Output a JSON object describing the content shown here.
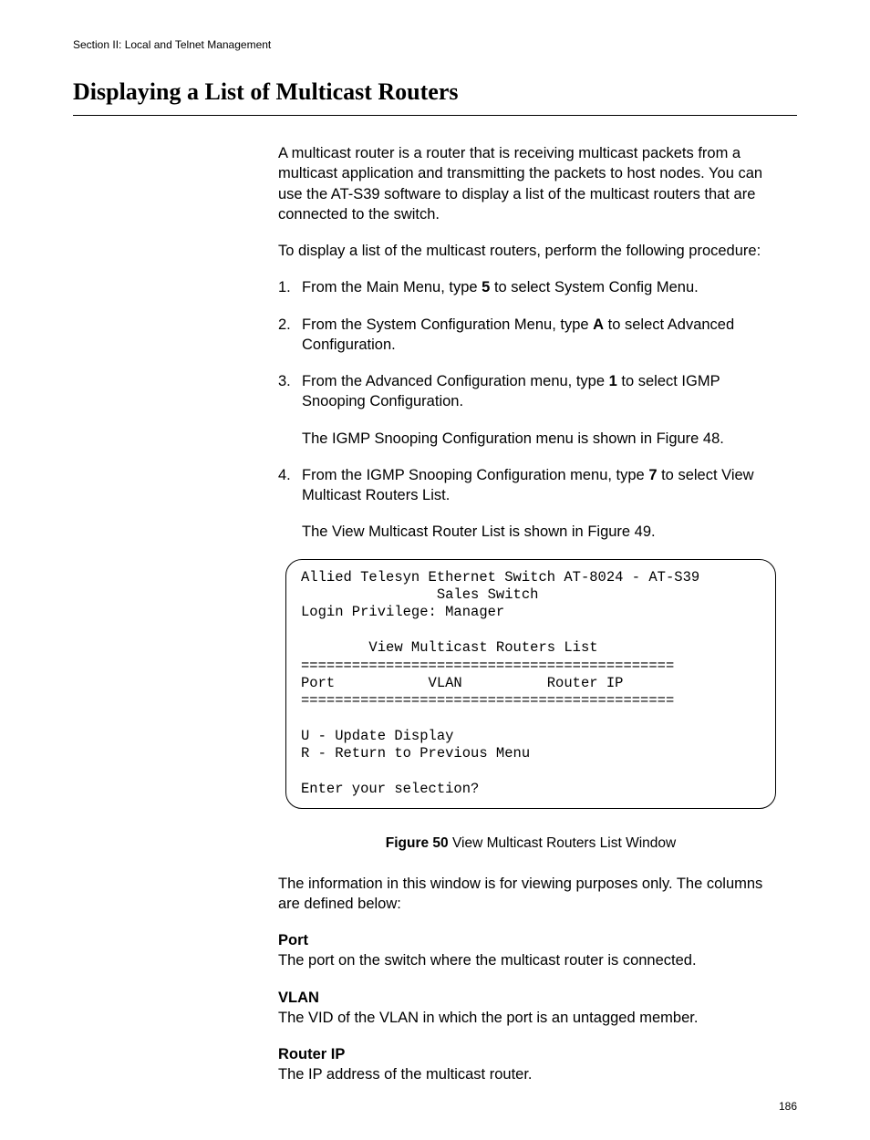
{
  "header": {
    "section_text": "Section II: Local and Telnet Management"
  },
  "heading": "Displaying a List of Multicast Routers",
  "intro_para": "A multicast router is a router that is receiving multicast packets from a multicast application and transmitting the packets to host nodes. You can use the AT-S39 software to display a list of the multicast routers that are connected to the switch.",
  "procedure_intro": "To display a list of the multicast routers, perform the following procedure:",
  "steps": [
    {
      "num": "1.",
      "before": "From the Main Menu, type ",
      "bold": "5",
      "after": " to select System Config Menu."
    },
    {
      "num": "2.",
      "before": "From the System Configuration Menu, type ",
      "bold": "A",
      "after": " to select Advanced Configuration."
    },
    {
      "num": "3.",
      "before": "From the Advanced Configuration menu, type ",
      "bold": "1",
      "after": " to select IGMP Snooping Configuration.",
      "note": "The IGMP Snooping Configuration menu is shown in Figure 48."
    },
    {
      "num": "4.",
      "before": "From the IGMP Snooping Configuration menu, type ",
      "bold": "7",
      "after": " to select View Multicast Routers List.",
      "note": "The View Multicast Router List is shown in Figure 49."
    }
  ],
  "terminal": "Allied Telesyn Ethernet Switch AT-8024 - AT-S39\n                Sales Switch\nLogin Privilege: Manager\n\n        View Multicast Routers List\n============================================\nPort           VLAN          Router IP\n============================================\n\nU - Update Display\nR - Return to Previous Menu\n\nEnter your selection?",
  "figure": {
    "label": "Figure 50",
    "caption": "  View Multicast Routers List Window"
  },
  "post_figure_para": "The information in this window is for viewing purposes only. The columns are defined below:",
  "definitions": [
    {
      "term": "Port",
      "desc": "The port on the switch where the multicast router is connected."
    },
    {
      "term": "VLAN",
      "desc": "The VID of the VLAN in which the port is an untagged member."
    },
    {
      "term": "Router IP",
      "desc": "The IP address of the multicast router."
    }
  ],
  "page_number": "186"
}
